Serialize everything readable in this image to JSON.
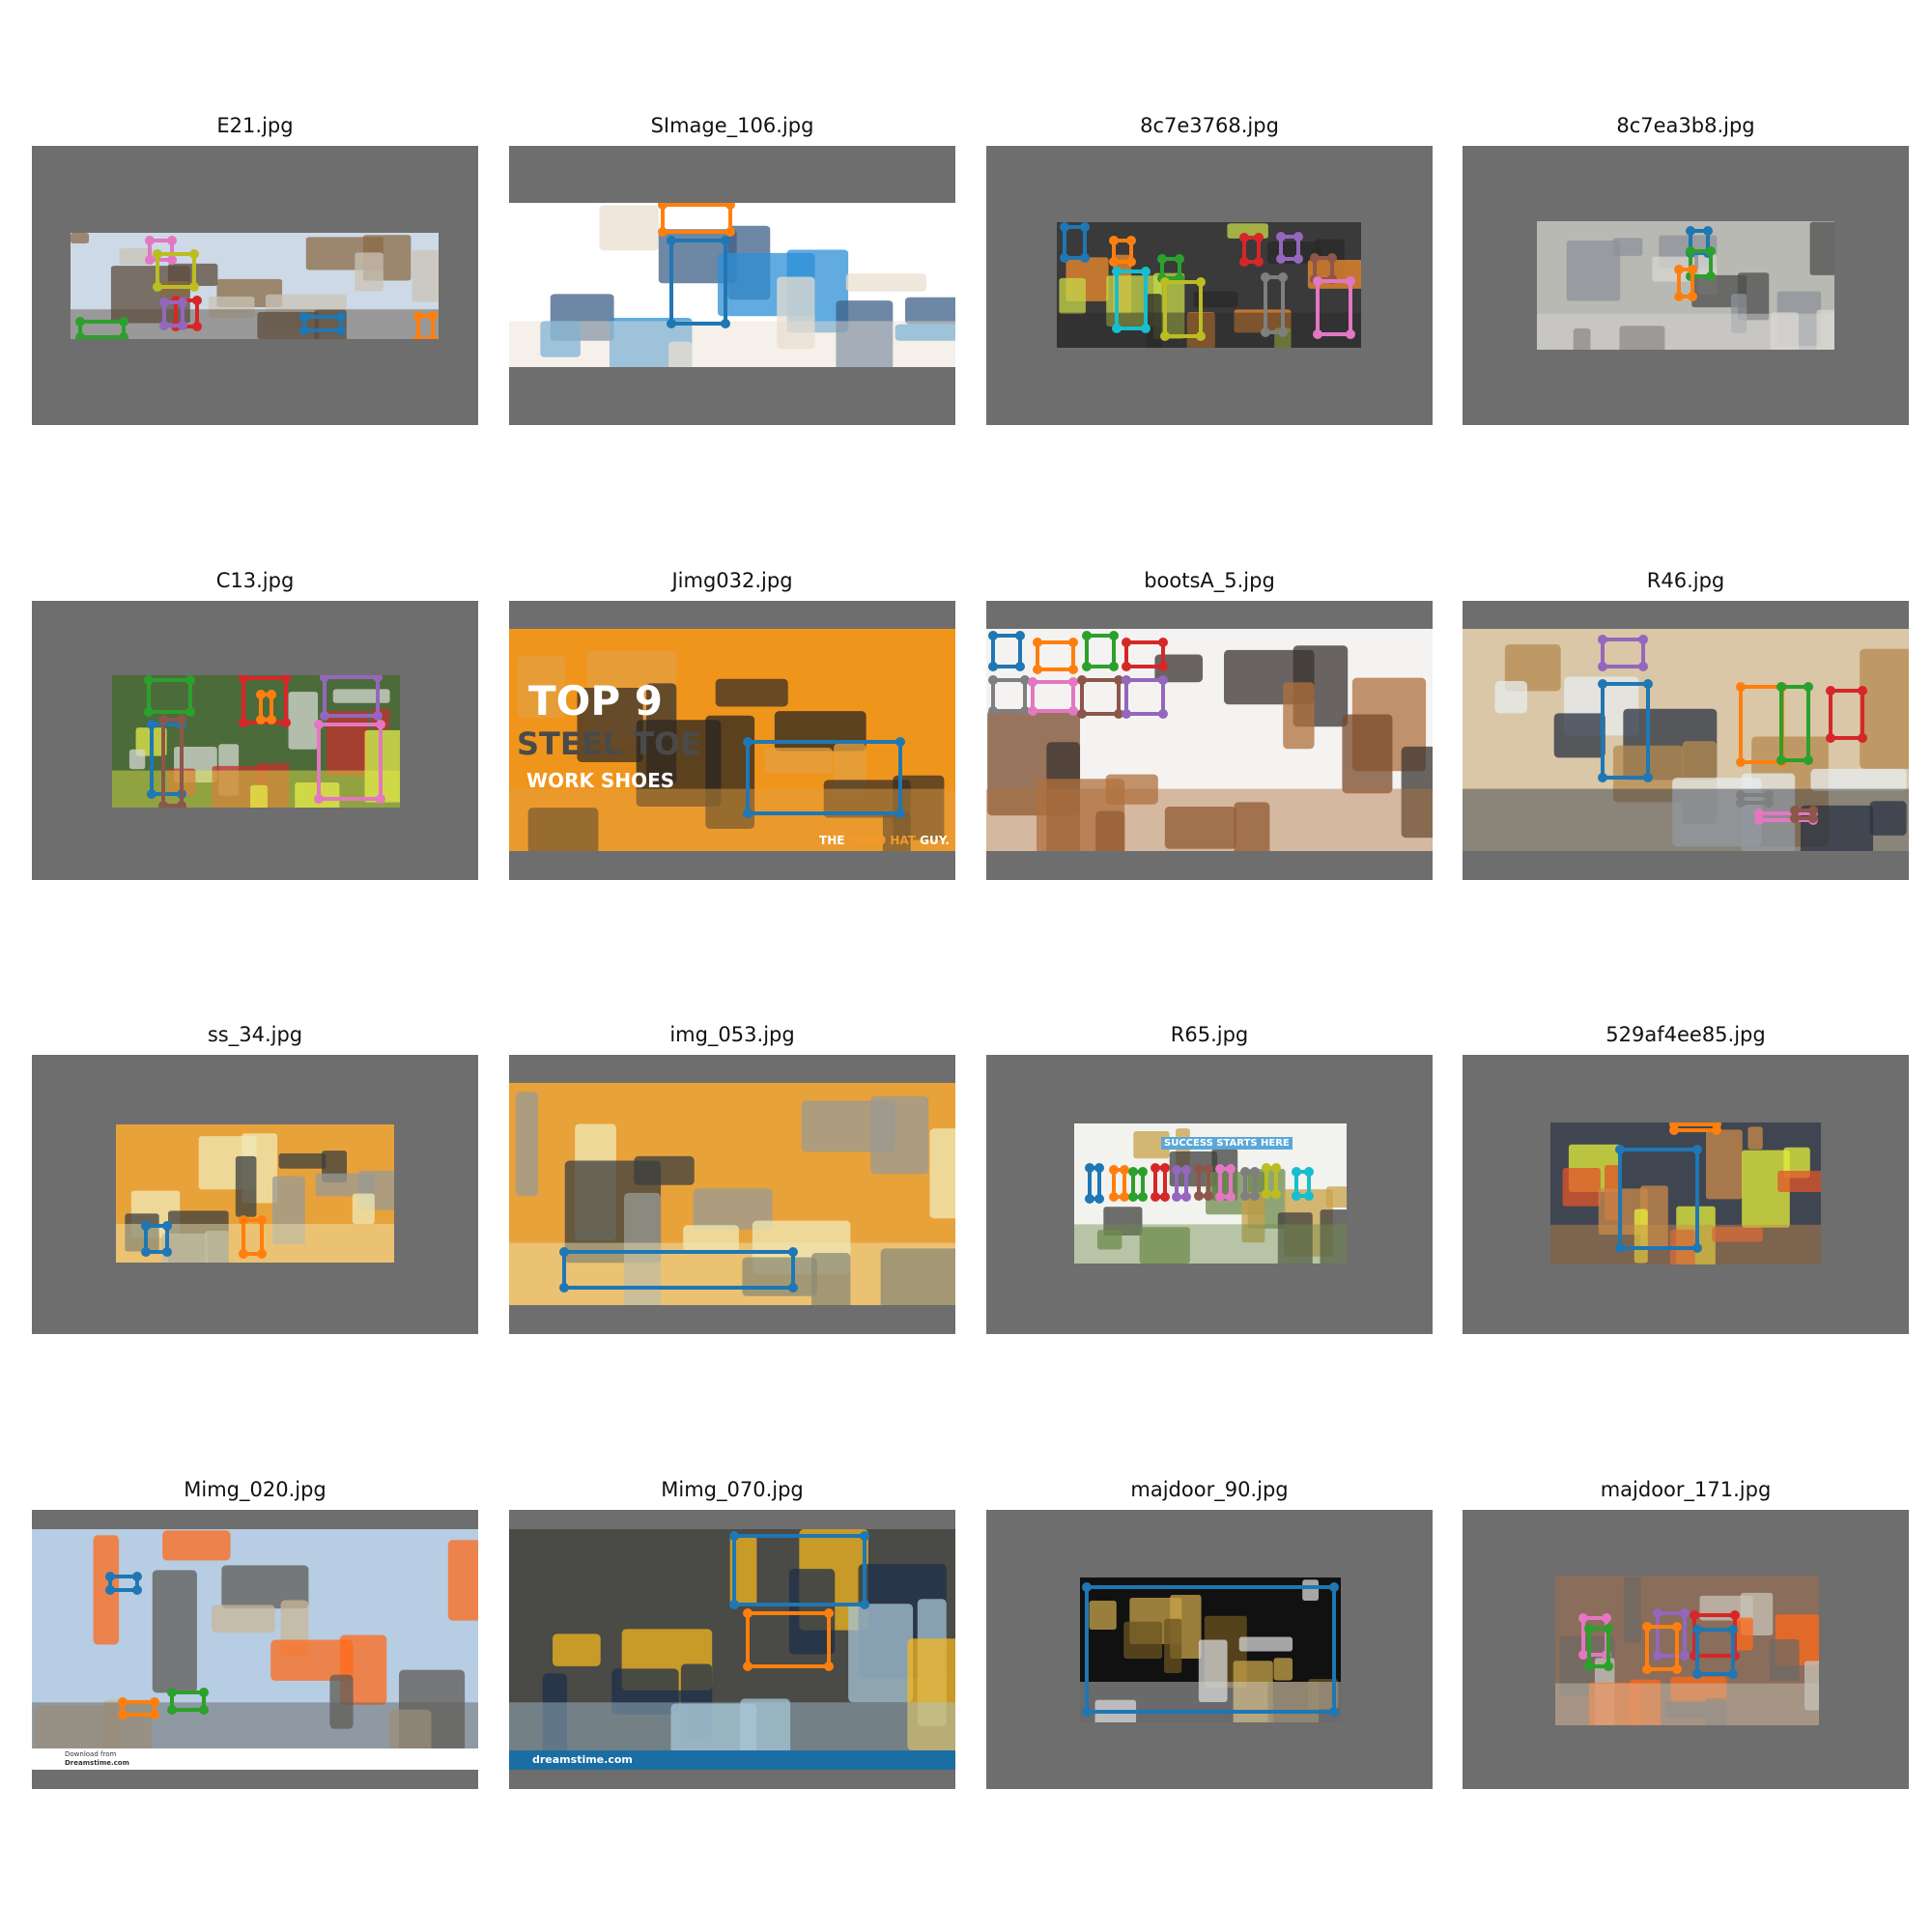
{
  "grid": {
    "panel_background": "#6e6e6e",
    "box_palette": [
      "#1f77b4",
      "#ff7f0e",
      "#2ca02c",
      "#d62728",
      "#9467bd",
      "#8c564b",
      "#e377c2",
      "#7f7f7f",
      "#bcbd22",
      "#17becf"
    ],
    "images": [
      {
        "title": "E21.jpg",
        "scene": "construction workers on a building site",
        "scene_colors": [
          "#cdd9e6",
          "#8a6a45",
          "#c9c3b5",
          "#5b4b3c"
        ],
        "photo_texts": [],
        "boxes": [
          {
            "color": "#e377c2"
          },
          {
            "color": "#bcbd22"
          },
          {
            "color": "#d62728"
          },
          {
            "color": "#9467bd"
          },
          {
            "color": "#2ca02c"
          },
          {
            "color": "#1f77b4"
          },
          {
            "color": "#ff7f0e"
          }
        ]
      },
      {
        "title": "SImage_106.jpg",
        "scene": "worker with blue hard hat and dust mask",
        "scene_colors": [
          "#ffffff",
          "#3e5f86",
          "#2c8fd6",
          "#e9ddd0"
        ],
        "photo_texts": [],
        "boxes": [
          {
            "color": "#ff7f0e"
          },
          {
            "color": "#1f77b4"
          }
        ]
      },
      {
        "title": "8c7e3768.jpg",
        "scene": "row of workers in safety vests",
        "scene_colors": [
          "#3a3a3a",
          "#f08c2e",
          "#c6d84a",
          "#2a2a2a"
        ],
        "photo_texts": [],
        "boxes": [
          {
            "color": "#1f77b4"
          },
          {
            "color": "#ff7f0e"
          },
          {
            "color": "#2ca02c"
          },
          {
            "color": "#d62728"
          },
          {
            "color": "#9467bd"
          },
          {
            "color": "#8c564b"
          },
          {
            "color": "#17becf"
          },
          {
            "color": "#bcbd22"
          },
          {
            "color": "#7f7f7f"
          },
          {
            "color": "#e377c2"
          }
        ]
      },
      {
        "title": "8c7ea3b8.jpg",
        "scene": "worker on scaffolding",
        "scene_colors": [
          "#b9b9b4",
          "#4f4f4f",
          "#8e9399",
          "#d9d7d2"
        ],
        "photo_texts": [],
        "boxes": [
          {
            "color": "#1f77b4"
          },
          {
            "color": "#2ca02c"
          },
          {
            "color": "#ff7f0e"
          }
        ]
      },
      {
        "title": "C13.jpg",
        "scene": "workers in red hard hats and vests",
        "scene_colors": [
          "#4c6b3a",
          "#d6d8d2",
          "#c0322e",
          "#e4e94a"
        ],
        "photo_texts": [],
        "boxes": [
          {
            "color": "#2ca02c"
          },
          {
            "color": "#d62728"
          },
          {
            "color": "#9467bd"
          },
          {
            "color": "#1f77b4"
          },
          {
            "color": "#ff7f0e"
          },
          {
            "color": "#8c564b"
          },
          {
            "color": "#e377c2"
          }
        ]
      },
      {
        "title": "Jimg032.jpg",
        "scene": "hands tying steel toe work shoes",
        "scene_colors": [
          "#f0951b",
          "#3b3027",
          "#2b2522",
          "#e3a043"
        ],
        "photo_texts": [
          "TOP 9",
          "STEEL TOE",
          "WORK SHOES",
          "THE ",
          "HARD HAT",
          " GUY."
        ],
        "boxes": [
          {
            "color": "#1f77b4"
          }
        ]
      },
      {
        "title": "bootsA_5.jpg",
        "scene": "catalog grid of work boots",
        "scene_colors": [
          "#f4f3f1",
          "#7a4a2a",
          "#3b3430",
          "#b0703e"
        ],
        "photo_texts": [],
        "boxes": [
          {
            "color": "#1f77b4"
          },
          {
            "color": "#ff7f0e"
          },
          {
            "color": "#2ca02c"
          },
          {
            "color": "#d62728"
          },
          {
            "color": "#7f7f7f"
          },
          {
            "color": "#e377c2"
          },
          {
            "color": "#8c564b"
          },
          {
            "color": "#9467bd"
          }
        ]
      },
      {
        "title": "R46.jpg",
        "scene": "warehouse workers in hi-vis vests",
        "scene_colors": [
          "#d9c7a7",
          "#b58a4f",
          "#e7ecef",
          "#2a3242"
        ],
        "photo_texts": [],
        "boxes": [
          {
            "color": "#9467bd"
          },
          {
            "color": "#1f77b4"
          },
          {
            "color": "#ff7f0e"
          },
          {
            "color": "#2ca02c"
          },
          {
            "color": "#d62728"
          },
          {
            "color": "#7f7f7f"
          },
          {
            "color": "#e377c2"
          },
          {
            "color": "#8c564b"
          }
        ]
      },
      {
        "title": "ss_34.jpg",
        "scene": "worker legs in orange trousers on gravel",
        "scene_colors": [
          "#e8a23a",
          "#3b3e3f",
          "#9a9a94",
          "#f0e9b8"
        ],
        "photo_texts": [],
        "boxes": [
          {
            "color": "#1f77b4"
          },
          {
            "color": "#ff7f0e"
          }
        ]
      },
      {
        "title": "img_053.jpg",
        "scene": "worker boots on railway gravel",
        "scene_colors": [
          "#e8a23a",
          "#3b3e3f",
          "#9a9a94",
          "#f0e9b8"
        ],
        "photo_texts": [],
        "boxes": [
          {
            "color": "#1f77b4"
          }
        ]
      },
      {
        "title": "R65.jpg",
        "scene": "large group photo in front of building",
        "scene_colors": [
          "#f2f2ef",
          "#c9a24a",
          "#3f3f3f",
          "#6f8b4d"
        ],
        "photo_texts": [
          "SUCCESS STARTS HERE"
        ],
        "boxes": [
          {
            "color": "#1f77b4"
          },
          {
            "color": "#ff7f0e"
          },
          {
            "color": "#2ca02c"
          },
          {
            "color": "#d62728"
          },
          {
            "color": "#9467bd"
          },
          {
            "color": "#8c564b"
          },
          {
            "color": "#e377c2"
          },
          {
            "color": "#7f7f7f"
          },
          {
            "color": "#bcbd22"
          },
          {
            "color": "#17becf"
          }
        ]
      },
      {
        "title": "529af4ee85.jpg",
        "scene": "worker in yellow vest by barrier",
        "scene_colors": [
          "#3f4652",
          "#e6ef3b",
          "#e2542b",
          "#c98a4a"
        ],
        "photo_texts": [],
        "boxes": [
          {
            "color": "#ff7f0e"
          },
          {
            "color": "#1f77b4"
          }
        ]
      },
      {
        "title": "Mimg_020.jpg",
        "scene": "worker in orange suit at oil field",
        "scene_colors": [
          "#b7cde3",
          "#c9b79a",
          "#ff6a1a",
          "#5f5b56"
        ],
        "photo_texts": [
          "Download from",
          "Dreamstime.com"
        ],
        "boxes": [
          {
            "color": "#1f77b4"
          },
          {
            "color": "#ff7f0e"
          },
          {
            "color": "#2ca02c"
          }
        ]
      },
      {
        "title": "Mimg_070.jpg",
        "scene": "worker with yellow hard hat and mask",
        "scene_colors": [
          "#4a4a46",
          "#f3b51f",
          "#1f2f4a",
          "#a7c6d5"
        ],
        "photo_texts": [
          "dreamstime.com"
        ],
        "boxes": [
          {
            "color": "#1f77b4"
          },
          {
            "color": "#ff7f0e"
          }
        ]
      },
      {
        "title": "majdoor_90.jpg",
        "scene": "mining helmet with headlamp",
        "scene_colors": [
          "#111111",
          "#c7a44a",
          "#6b5321",
          "#d8d8d8"
        ],
        "photo_texts": [],
        "boxes": [
          {
            "color": "#1f77b4"
          }
        ]
      },
      {
        "title": "majdoor_171.jpg",
        "scene": "workers walking on site",
        "scene_colors": [
          "#8a6d5a",
          "#ff6a1a",
          "#6d6a64",
          "#c8c3b8"
        ],
        "photo_texts": [],
        "boxes": [
          {
            "color": "#e377c2"
          },
          {
            "color": "#9467bd"
          },
          {
            "color": "#d62728"
          },
          {
            "color": "#2ca02c"
          },
          {
            "color": "#ff7f0e"
          },
          {
            "color": "#1f77b4"
          }
        ]
      }
    ]
  }
}
